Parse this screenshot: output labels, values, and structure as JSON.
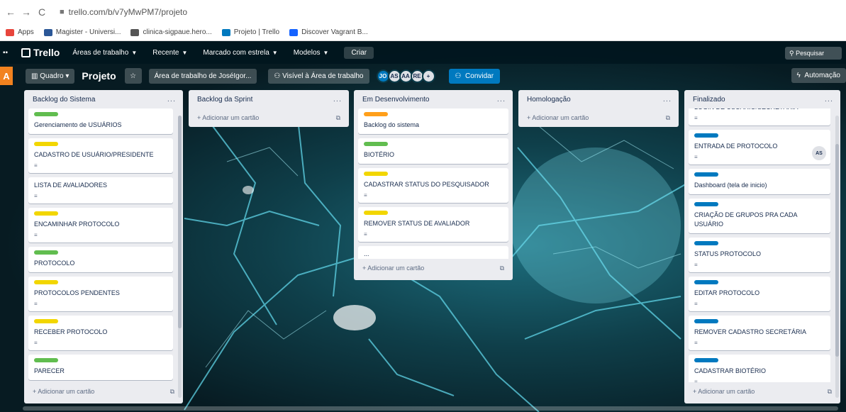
{
  "browser": {
    "back": "←",
    "forward": "→",
    "reload": "C",
    "url": "trello.com/b/v7yMwPM7/projeto",
    "bookmarks": [
      {
        "label": "Apps",
        "color": "#e8453c"
      },
      {
        "label": "Magister - Universi...",
        "color": "#2b5797"
      },
      {
        "label": "clinica-sigpaue.hero...",
        "color": "#555555"
      },
      {
        "label": "Projeto | Trello",
        "color": "#0079bf"
      },
      {
        "label": "Discover Vagrant B...",
        "color": "#1563ff"
      }
    ]
  },
  "header": {
    "logo": "Trello",
    "menus": [
      "Áreas de trabalho",
      "Recente",
      "Marcado com estrela",
      "Modelos"
    ],
    "create": "Criar",
    "search": "Pesquisar"
  },
  "board": {
    "workspace_initial": "A",
    "view": "Quadro",
    "title": "Projeto",
    "workspace": "Área de trabalho de JoséIgor...",
    "visibility": "Visível à Área de trabalho",
    "members": [
      "JO",
      "AS",
      "AA",
      "RE",
      "+"
    ],
    "invite": "Convidar",
    "automation": "Automação"
  },
  "lists": [
    {
      "title": "Backlog do Sistema",
      "cards": [
        {
          "label": "#61bd4f",
          "title": "Gerenciamento de USUÁRIOS",
          "desc": false
        },
        {
          "label": "#f2d600",
          "title": "CADASTRO DE USUÁRIO/PRESIDENTE",
          "desc": true
        },
        {
          "label": "",
          "title": "LISTA DE AVALIADORES",
          "desc": true
        },
        {
          "label": "#f2d600",
          "title": "ENCAMINHAR PROTOCOLO",
          "desc": true
        },
        {
          "label": "#61bd4f",
          "title": "PROTOCOLO",
          "desc": false
        },
        {
          "label": "#f2d600",
          "title": "PROTOCOLOS PENDENTES",
          "desc": true
        },
        {
          "label": "#f2d600",
          "title": "RECEBER PROTOCOLO",
          "desc": true
        },
        {
          "label": "#61bd4f",
          "title": "PARECER",
          "desc": false
        }
      ],
      "add": "+ Adicionar um cartão"
    },
    {
      "title": "Backlog da Sprint",
      "cards": [],
      "add": "+ Adicionar um cartão"
    },
    {
      "title": "Em Desenvolvimento",
      "cards": [
        {
          "label": "#ff9f1a",
          "title": "Backlog do sistema",
          "desc": false
        },
        {
          "label": "#61bd4f",
          "title": "BIOTÉRIO",
          "desc": false
        },
        {
          "label": "#f2d600",
          "title": "CADASTRAR STATUS DO PESQUISADOR",
          "desc": true
        },
        {
          "label": "#f2d600",
          "title": "REMOVER STATUS DE AVALIADOR",
          "desc": true
        },
        {
          "label": "",
          "title": "...",
          "desc": false
        }
      ],
      "add": "+ Adicionar um cartão"
    },
    {
      "title": "Homologação",
      "cards": [],
      "add": "+ Adicionar um cartão"
    },
    {
      "title": "Finalizado",
      "cards": [
        {
          "label": "",
          "title": "LOGIN DE USUÁRIO/SECRETÁRIA",
          "desc": true,
          "cut": true
        },
        {
          "label": "#0079bf",
          "title": "ENTRADA DE PROTOCOLO",
          "desc": true,
          "avatar": "AS"
        },
        {
          "label": "#0079bf",
          "title": "Dashboard (tela de inicio)",
          "desc": false
        },
        {
          "label": "#0079bf",
          "title": "CRIAÇÃO DE GRUPOS PRA CADA USUÁRIO",
          "desc": false
        },
        {
          "label": "#0079bf",
          "title": "STATUS PROTOCOLO",
          "desc": true
        },
        {
          "label": "#0079bf",
          "title": "EDITAR PROTOCOLO",
          "desc": true
        },
        {
          "label": "#0079bf",
          "title": "REMOVER CADASTRO SECRETÁRIA",
          "desc": true
        },
        {
          "label": "#0079bf",
          "title": "CADASTRAR BIOTÉRIO",
          "desc": true
        }
      ],
      "add": "+ Adicionar um cartão"
    }
  ],
  "icons": {
    "description": "≡",
    "template": "⧉",
    "menu": "..."
  }
}
